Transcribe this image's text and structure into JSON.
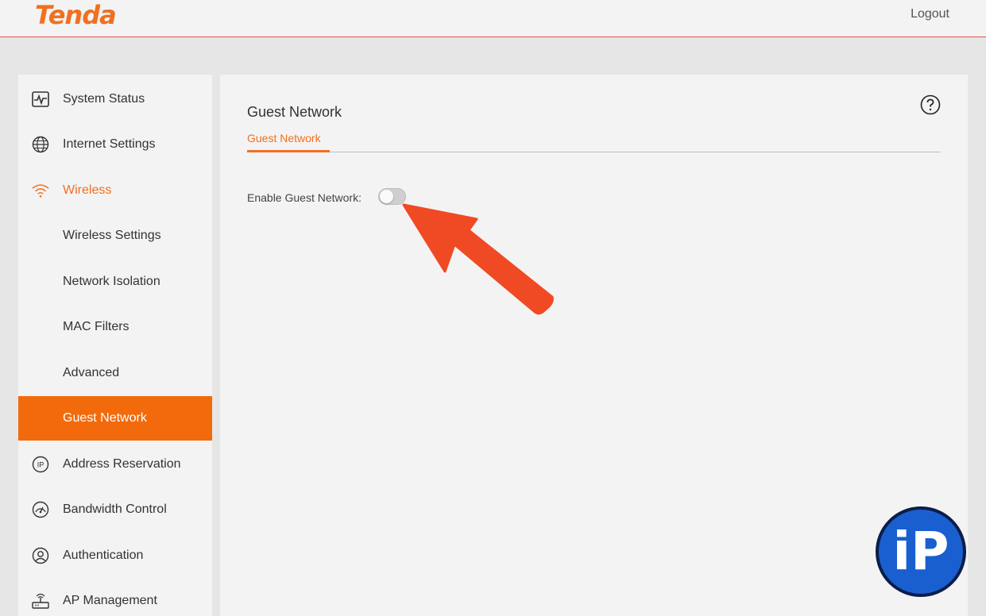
{
  "header": {
    "logo": "Tenda",
    "logout_label": "Logout"
  },
  "sidebar": {
    "items": [
      {
        "label": "System Status",
        "icon": "activity-monitor-icon"
      },
      {
        "label": "Internet Settings",
        "icon": "globe-icon"
      },
      {
        "label": "Wireless",
        "icon": "wifi-icon"
      },
      {
        "label": "Wireless Settings"
      },
      {
        "label": "Network Isolation"
      },
      {
        "label": "MAC Filters"
      },
      {
        "label": "Advanced"
      },
      {
        "label": "Guest Network"
      },
      {
        "label": "Address Reservation",
        "icon": "ip-icon"
      },
      {
        "label": "Bandwidth Control",
        "icon": "speedometer-icon"
      },
      {
        "label": "Authentication",
        "icon": "user-circle-icon"
      },
      {
        "label": "AP Management",
        "icon": "router-icon"
      }
    ],
    "active_item": "Guest Network"
  },
  "main": {
    "title": "Guest Network",
    "tabs": [
      {
        "label": "Guest Network"
      }
    ],
    "enable_label": "Enable Guest Network:",
    "enable_value": "off"
  },
  "watermark": {
    "text": "iP"
  },
  "colors": {
    "accent": "#f07020",
    "active_bg": "#f26a0c",
    "header_line": "#e0534a",
    "arrow": "#f04a25",
    "badge_blue": "#1a5fd0"
  }
}
